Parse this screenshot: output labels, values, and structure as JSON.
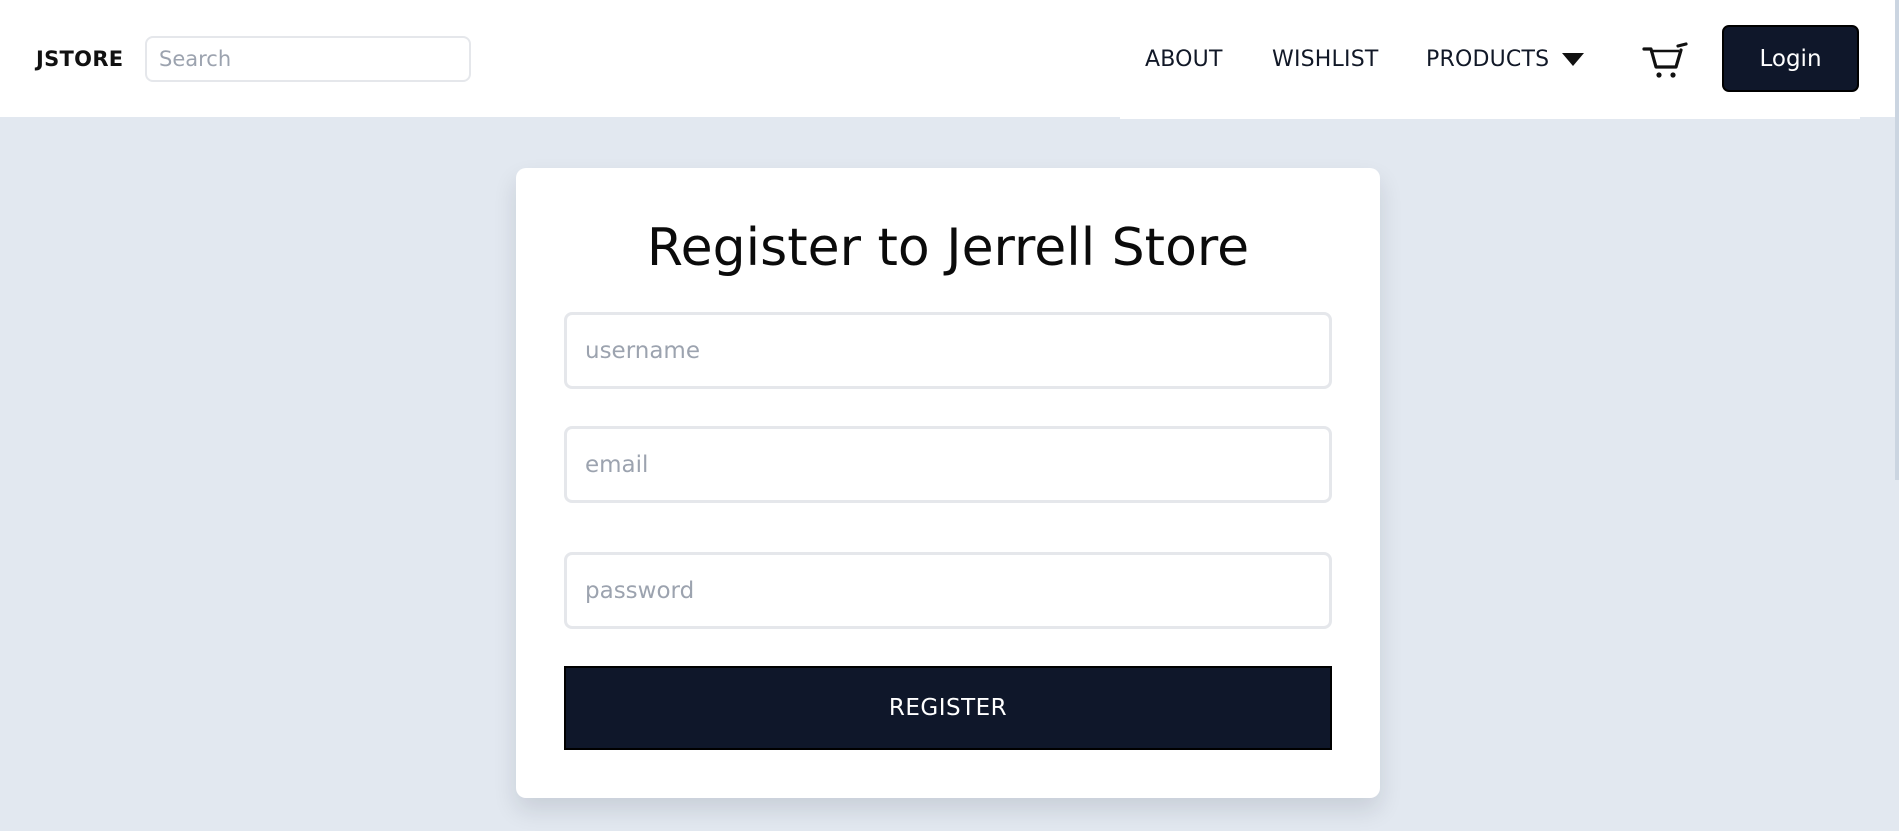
{
  "header": {
    "brand": "JSTORE",
    "search_placeholder": "Search",
    "nav": {
      "about": "ABOUT",
      "wishlist": "WISHLIST",
      "products": "PRODUCTS"
    },
    "icons": {
      "products_dropdown": "caret-down-icon",
      "cart": "shopping-cart-icon"
    },
    "login_label": "Login"
  },
  "register_form": {
    "title": "Register to Jerrell Store",
    "username_placeholder": "username",
    "email_placeholder": "email",
    "password_placeholder": "password",
    "submit_label": "REGISTER"
  },
  "colors": {
    "page_background": "#e2e8f0",
    "primary_dark": "#0f172a",
    "input_border": "#e5e7eb",
    "placeholder_text": "#9ca3af"
  }
}
